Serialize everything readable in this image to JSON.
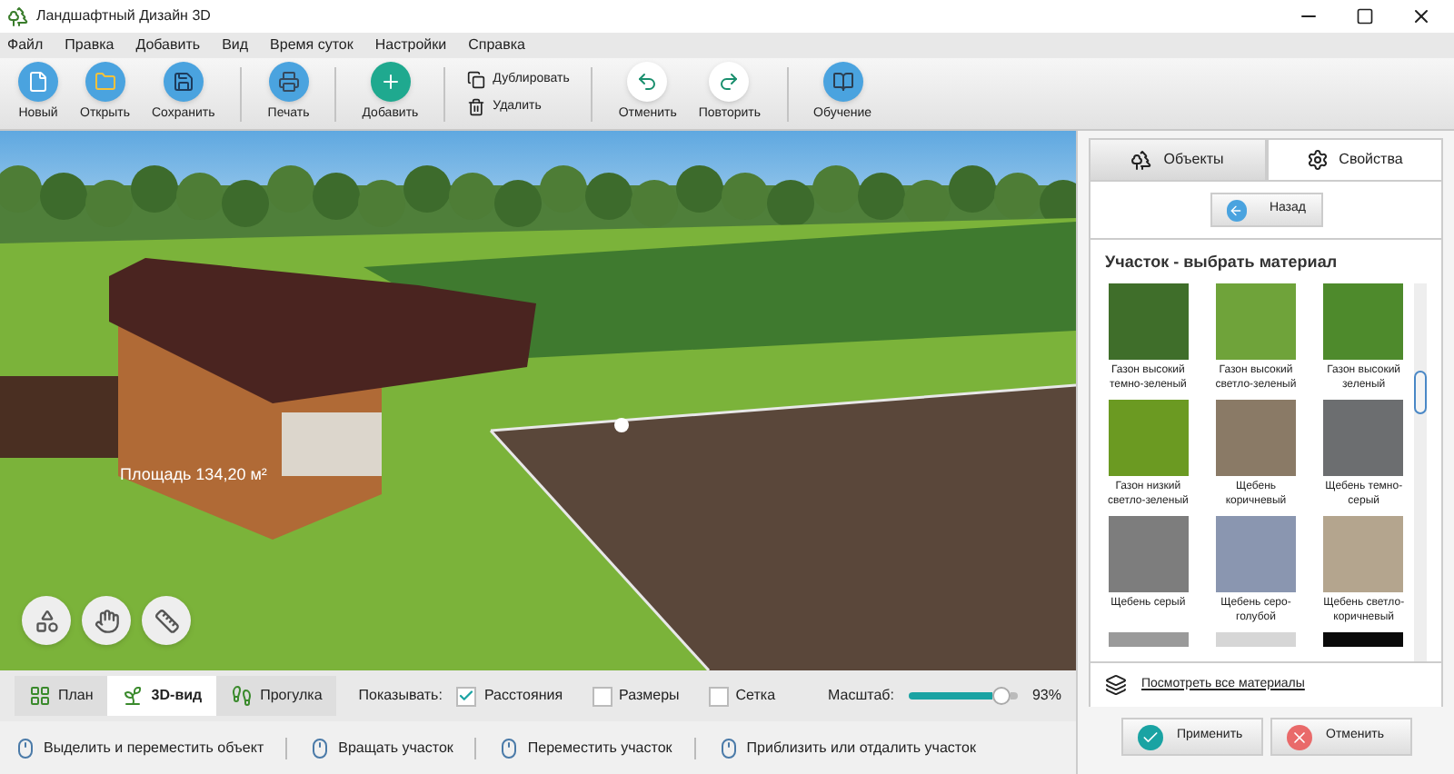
{
  "window": {
    "title": "Ландшафтный Дизайн 3D"
  },
  "menu": [
    "Файл",
    "Правка",
    "Добавить",
    "Вид",
    "Время суток",
    "Настройки",
    "Справка"
  ],
  "toolbar": {
    "groups": [
      {
        "kind": "large",
        "buttons": [
          "Новый",
          "Открыть",
          "Сохранить"
        ]
      },
      {
        "kind": "large",
        "buttons": [
          "Печать"
        ]
      },
      {
        "kind": "large",
        "buttons": [
          "Добавить"
        ]
      },
      {
        "kind": "stacked",
        "buttons": [
          "Дублировать",
          "Удалить"
        ]
      },
      {
        "kind": "large",
        "buttons": [
          "Отменить",
          "Повторить"
        ]
      },
      {
        "kind": "large",
        "buttons": [
          "Обучение"
        ]
      }
    ]
  },
  "scene": {
    "area_label": "Площадь 134,20 м²"
  },
  "view_tabs": [
    {
      "label": "План",
      "selected": false
    },
    {
      "label": "3D-вид",
      "selected": true
    },
    {
      "label": "Прогулка",
      "selected": false
    }
  ],
  "show": {
    "label": "Показывать:",
    "options": [
      {
        "label": "Расстояния",
        "checked": true
      },
      {
        "label": "Размеры",
        "checked": false
      },
      {
        "label": "Сетка",
        "checked": false
      }
    ]
  },
  "zoom": {
    "label": "Масштаб:",
    "level": 0.93,
    "reading": "93%"
  },
  "status_bar": [
    "Выделить и переместить объект",
    "Вращать участок",
    "Переместить участок",
    "Приблизить или отдалить участок"
  ],
  "panel": {
    "tabs": [
      {
        "label": "Объекты",
        "selected": false
      },
      {
        "label": "Свойства",
        "selected": true
      }
    ],
    "back": "Назад",
    "heading": "Участок - выбрать материал",
    "materials": [
      {
        "label": "Газон высокий темно-зеленый",
        "color": "#3f6e2a"
      },
      {
        "label": "Газон высокий светло-зеленый",
        "color": "#6fa33a"
      },
      {
        "label": "Газон высокий зеленый",
        "color": "#4e8a2c"
      },
      {
        "label": "Газон низкий светло-зеленый",
        "color": "#6b9a22"
      },
      {
        "label": "Щебень коричневый",
        "color": "#8a7a66"
      },
      {
        "label": "Щебень темно-серый",
        "color": "#6c6e70"
      },
      {
        "label": "Щебень серый",
        "color": "#7d7d7d"
      },
      {
        "label": "Щебень серо-голубой",
        "color": "#8a96b0"
      },
      {
        "label": "Щебень светло-коричневый",
        "color": "#b4a58e"
      },
      {
        "color": "#9a9a9a"
      },
      {
        "color": "#d6d6d6"
      },
      {
        "color": "#0a0a0a"
      }
    ],
    "all_link": "Посмотреть все материалы",
    "buttons": [
      {
        "label": "Применить",
        "kind": "apply"
      },
      {
        "label": "Отменить",
        "kind": "cancel"
      }
    ]
  }
}
